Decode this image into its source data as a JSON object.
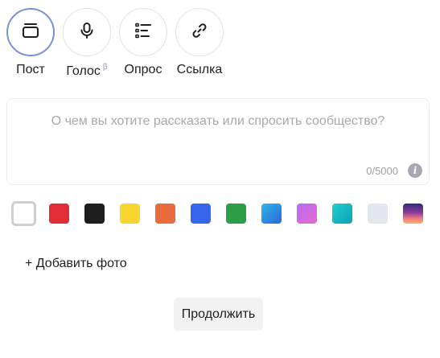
{
  "post_types": [
    {
      "label": "Пост",
      "icon": "post-card-icon",
      "active": true
    },
    {
      "label": "Голос",
      "superscript": "β",
      "icon": "microphone-icon",
      "active": false
    },
    {
      "label": "Опрос",
      "icon": "poll-list-icon",
      "active": false
    },
    {
      "label": "Ссылка",
      "icon": "link-icon",
      "active": false
    }
  ],
  "compose": {
    "placeholder": "О чем вы хотите рассказать или спросить сообщество?",
    "counter": "0/5000",
    "info_glyph": "i"
  },
  "backgrounds": [
    {
      "name": "white",
      "color": "#ffffff",
      "selected": true
    },
    {
      "name": "red",
      "color": "#e02d36"
    },
    {
      "name": "black",
      "color": "#1e1e1e"
    },
    {
      "name": "yellow",
      "color": "#f8d52f"
    },
    {
      "name": "orange",
      "color": "#e96a3c"
    },
    {
      "name": "blue",
      "color": "#3566ec"
    },
    {
      "name": "green",
      "color": "#2b9e46"
    },
    {
      "name": "sky-gradient",
      "gradient": "linear-gradient(135deg, #2fb7e9, #2a66d6)"
    },
    {
      "name": "violet-gradient",
      "gradient": "linear-gradient(135deg, #b86bf0, #e56ad0)"
    },
    {
      "name": "teal-gradient",
      "gradient": "linear-gradient(135deg, #1fd0cf, #0d9fb5)"
    },
    {
      "name": "light-gray",
      "color": "#e3e6ee"
    },
    {
      "name": "sunset-gradient",
      "gradient": "linear-gradient(180deg, #2f2a7c 0%, #8c3b9e 45%, #f27a7a 75%, #ffb36b 100%)"
    }
  ],
  "add_photo_label": "+ Добавить фото",
  "continue_label": "Продолжить",
  "colors": {
    "active_ring": "#7a93d8",
    "continue_bg": "#f2f2f2",
    "placeholder_text": "#a8a8a8"
  }
}
